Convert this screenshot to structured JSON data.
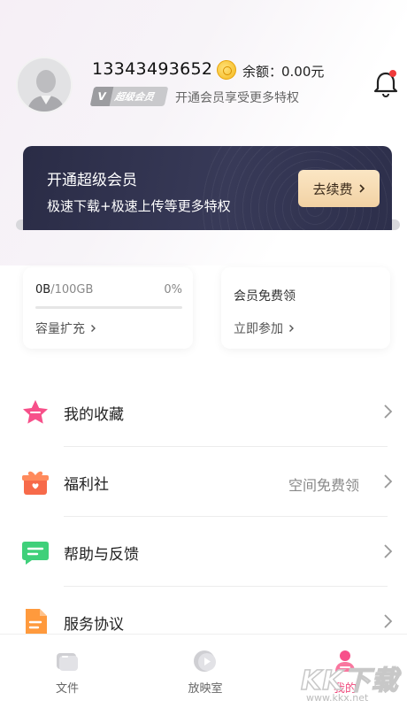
{
  "profile": {
    "phone": "13343493652",
    "balance_label": "余额：",
    "balance_value": "0.00元",
    "vip_badge_text": "超级会员",
    "vip_badge_v": "V",
    "vip_tip": "开通会员享受更多特权"
  },
  "banner": {
    "title": "开通超级会员",
    "subtitle": "极速下载+极速上传等更多特权",
    "renew_label": "去续费"
  },
  "storage_card": {
    "used": "0B",
    "total": "/100GB",
    "percent": "0%",
    "progress": 0,
    "link_label": "容量扩充"
  },
  "free_card": {
    "title": "会员免费领",
    "link_label": "立即参加"
  },
  "menu": [
    {
      "label": "我的收藏",
      "value": "",
      "icon": "star-icon"
    },
    {
      "label": "福利社",
      "value": "空间免费领",
      "icon": "gift-icon"
    },
    {
      "label": "帮助与反馈",
      "value": "",
      "icon": "chat-icon"
    },
    {
      "label": "服务协议",
      "value": "",
      "icon": "document-icon"
    }
  ],
  "bottom_nav": [
    {
      "label": "文件",
      "icon": "folder-icon",
      "active": false
    },
    {
      "label": "放映室",
      "icon": "play-icon",
      "active": false
    },
    {
      "label": "我的",
      "icon": "profile-icon",
      "active": true
    }
  ],
  "watermark": {
    "logo": "KK下载",
    "url": "www.kkx.net"
  },
  "colors": {
    "accent": "#f04a7d",
    "banner_bg": "#2d2f4b",
    "renew_btn": "#f6dcb3"
  }
}
